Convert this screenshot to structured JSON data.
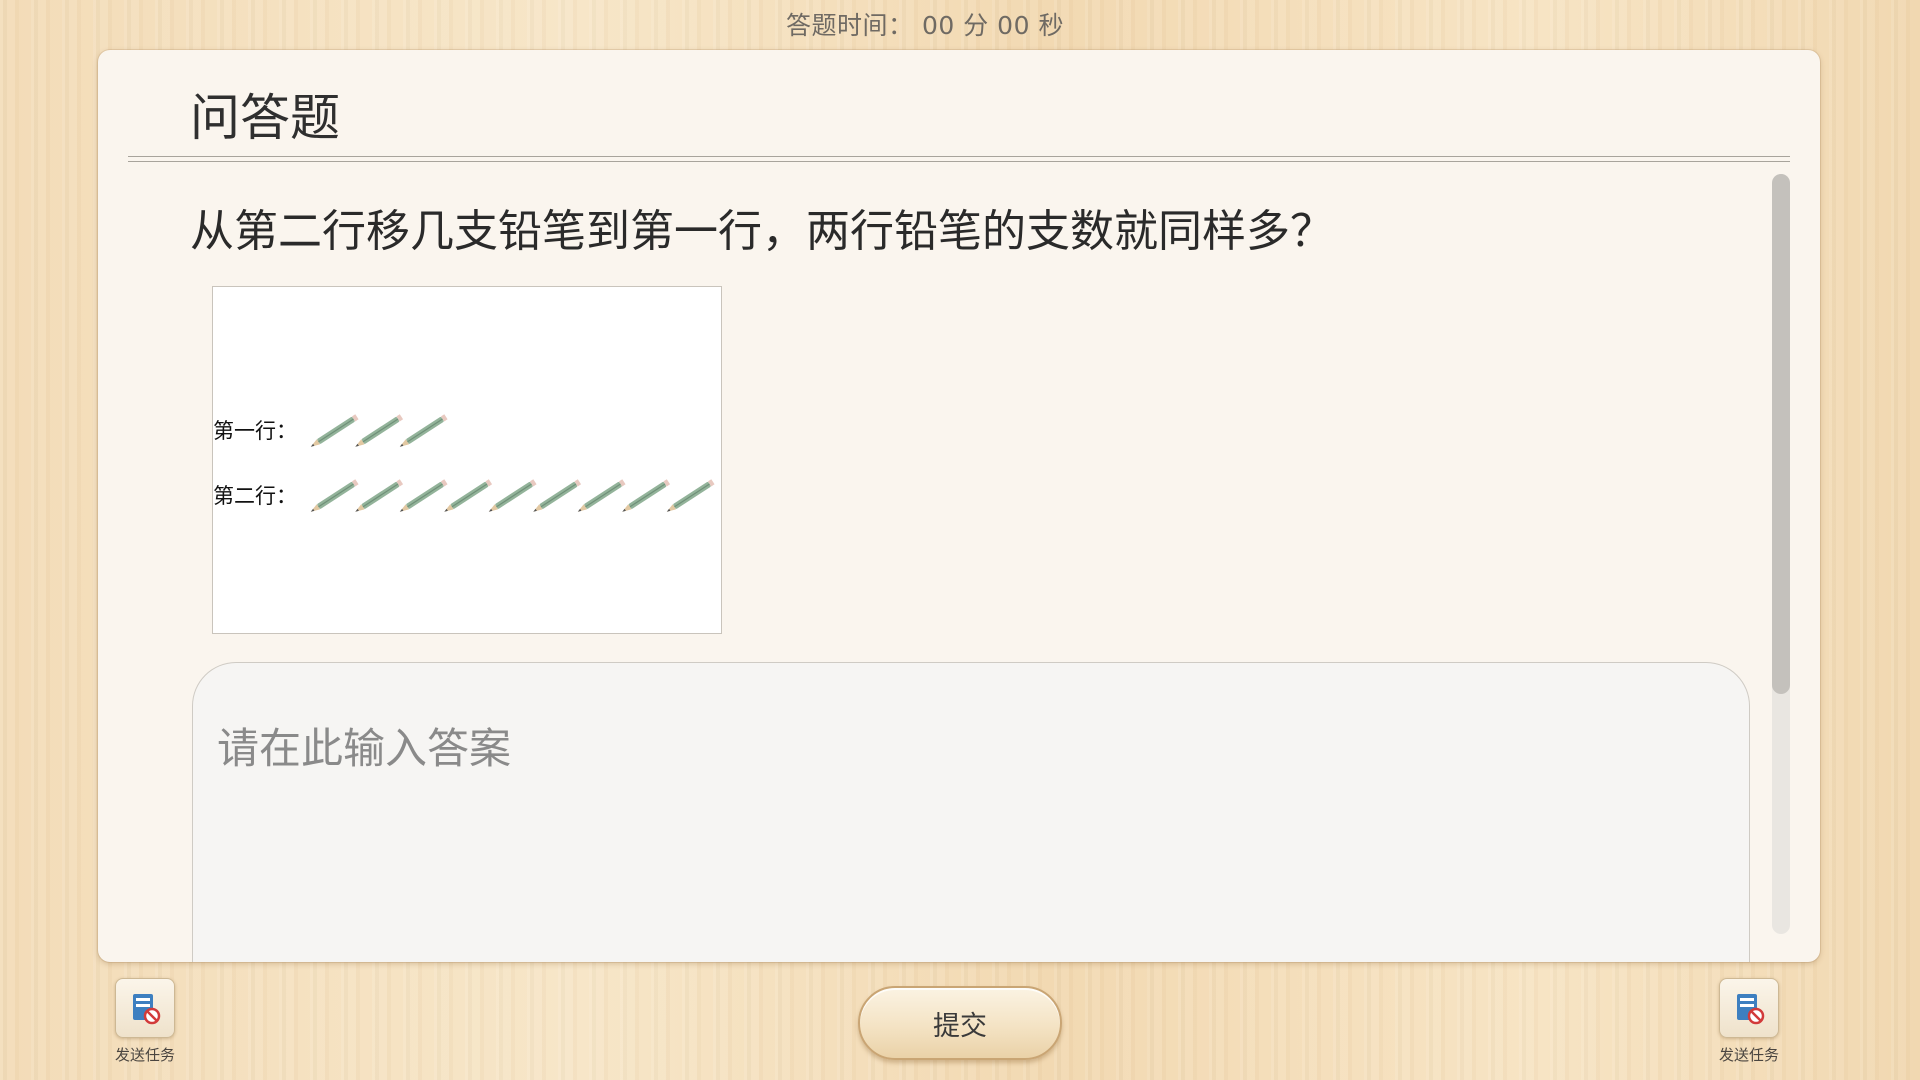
{
  "timer": {
    "text": "答题时间： 00 分 00 秒"
  },
  "card": {
    "title": "问答题",
    "question": "从第二行移几支铅笔到第一行，两行铅笔的支数就同样多？",
    "figure": {
      "row1_label": "第一行：",
      "row1_pencil_count": 3,
      "row2_label": "第二行：",
      "row2_pencil_count": 9
    },
    "answer": {
      "placeholder": "请在此输入答案",
      "value": ""
    }
  },
  "footer": {
    "submit_label": "提交",
    "send_task_left_label": "发送任务",
    "send_task_right_label": "发送任务"
  },
  "colors": {
    "pencil_body": "#93b39a",
    "pencil_tip": "#e2c8a2",
    "card_bg": "#faf5ee",
    "icon_blue": "#3d7fc0",
    "icon_red": "#d23a3a"
  }
}
